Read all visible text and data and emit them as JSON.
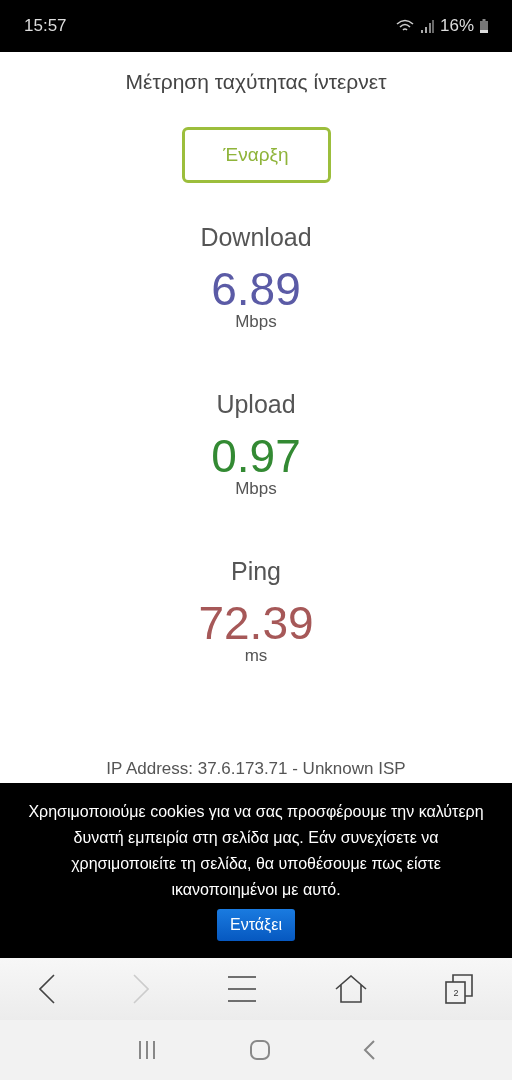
{
  "status_bar": {
    "time": "15:57",
    "battery": "16%"
  },
  "title": "Μέτρηση ταχύτητας ίντερνετ",
  "start_button": "Έναρξη",
  "metrics": [
    {
      "label": "Download",
      "value": "6.89",
      "unit": "Mbps",
      "color": "#5b5ba6"
    },
    {
      "label": "Upload",
      "value": "0.97",
      "unit": "Mbps",
      "color": "#338a33"
    },
    {
      "label": "Ping",
      "value": "72.39",
      "unit": "ms",
      "color": "#a65858"
    }
  ],
  "ip_info": "IP Address: 37.6.173.71 - Unknown ISP",
  "cookie_banner": {
    "text": "Χρησιμοποιούμε cookies για να σας προσφέρουμε την καλύτερη δυνατή εμπειρία στη σελίδα μας. Εάν συνεχίσετε να χρησιμοποιείτε τη σελίδα, θα υποθέσουμε πως είστε ικανοποιημένοι με αυτό.",
    "button": "Εντάξει"
  },
  "browser_toolbar": {
    "back_disabled": false,
    "forward_disabled": true,
    "tab_count": "2"
  }
}
